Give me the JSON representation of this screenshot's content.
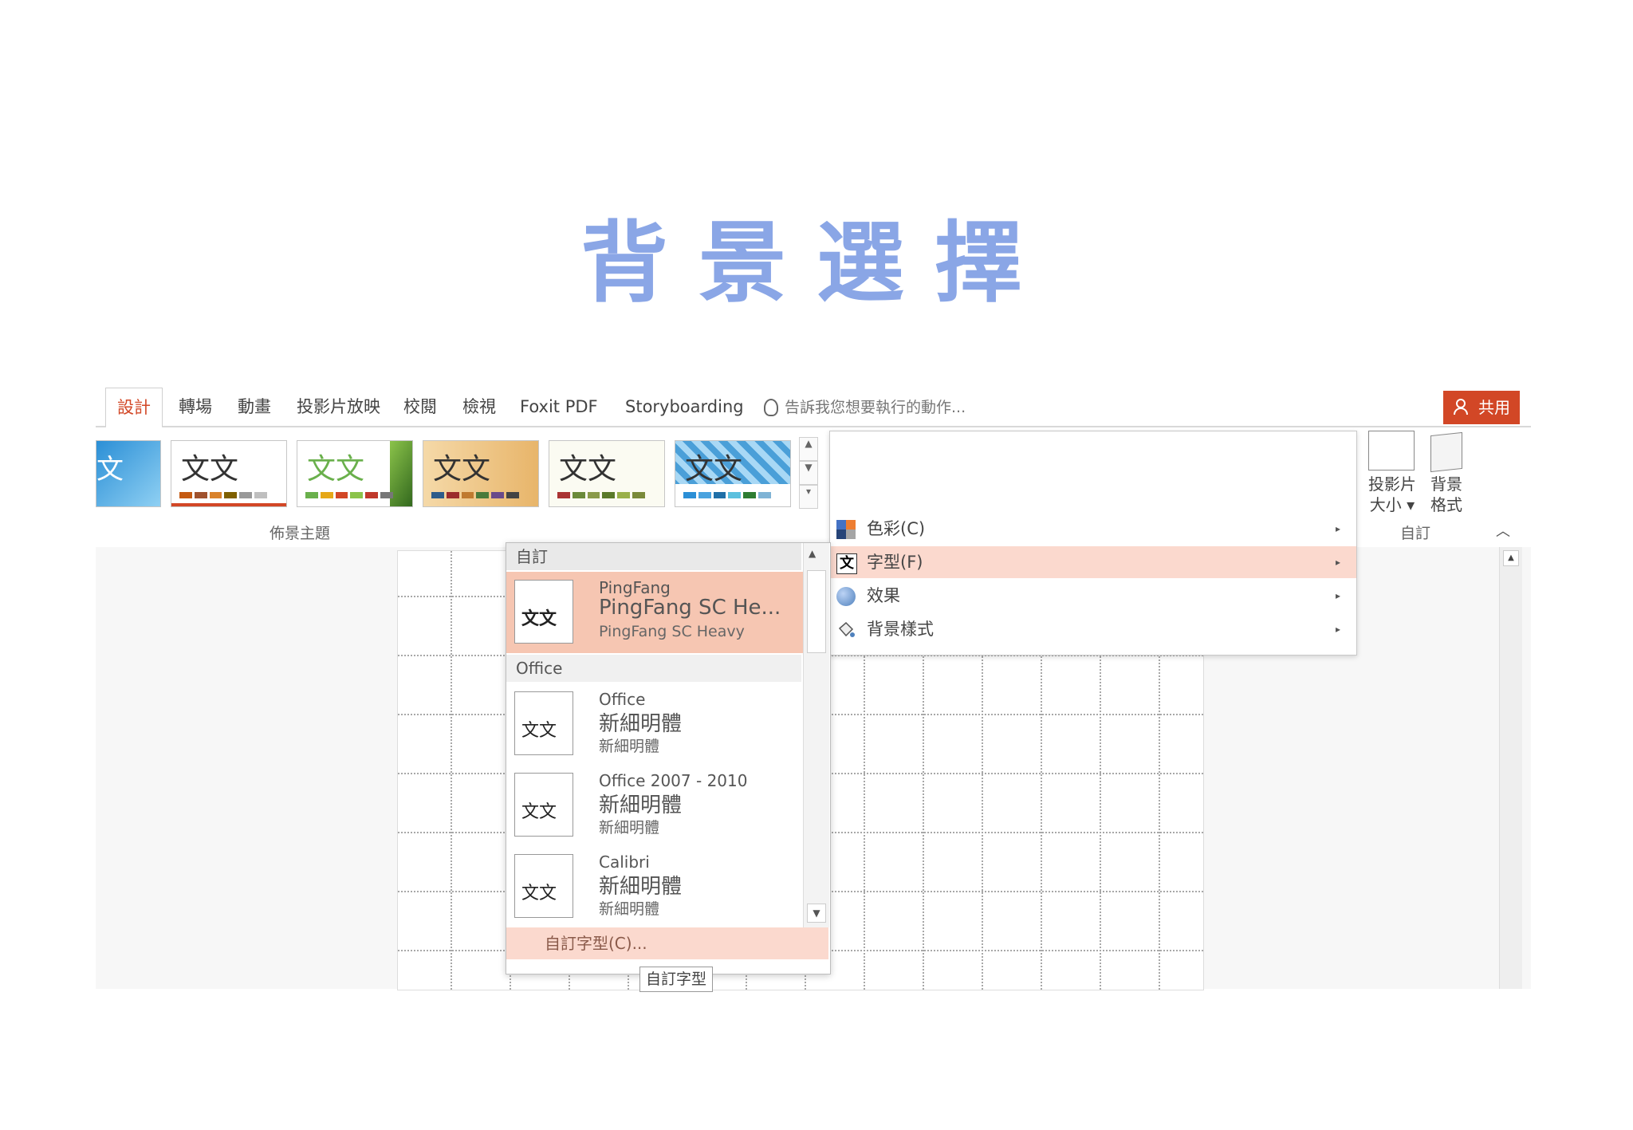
{
  "page_title": "背景選擇",
  "tabs": [
    "設計",
    "轉場",
    "動畫",
    "投影片放映",
    "校閱",
    "檢視",
    "Foxit PDF",
    "Storyboarding"
  ],
  "tell_me": "告訴我您想要執行的動作...",
  "share_label": "共用",
  "themes_group_label": "佈景主題",
  "theme_sample_text": "文文",
  "customize_group_label": "自訂",
  "slide_size_label_1": "投影片",
  "slide_size_label_2": "大小",
  "bg_format_label_1": "背景",
  "bg_format_label_2": "格式",
  "variant_menu": {
    "colors": "色彩(C)",
    "fonts": "字型(F)",
    "effects": "效果",
    "bg_styles": "背景樣式"
  },
  "font_panel": {
    "custom_header": "自訂",
    "office_header": "Office",
    "items": [
      {
        "name": "PingFang",
        "heading": "PingFang SC He...",
        "body": "PingFang SC Heavy",
        "thumb": "文文"
      },
      {
        "name": "Office",
        "heading": "新細明體",
        "body": "新細明體",
        "thumb": "文文"
      },
      {
        "name": "Office 2007 - 2010",
        "heading": "新細明體",
        "body": "新細明體",
        "thumb": "文文"
      },
      {
        "name": "Calibri",
        "heading": "新細明體",
        "body": "新細明體",
        "thumb": "文文"
      }
    ],
    "customize_fonts": "自訂字型(C)...",
    "tooltip": "自訂字型"
  },
  "colors": {
    "accent": "#d24726",
    "title_blue": "#8aa6e6",
    "selection": "#f6c6b2"
  }
}
